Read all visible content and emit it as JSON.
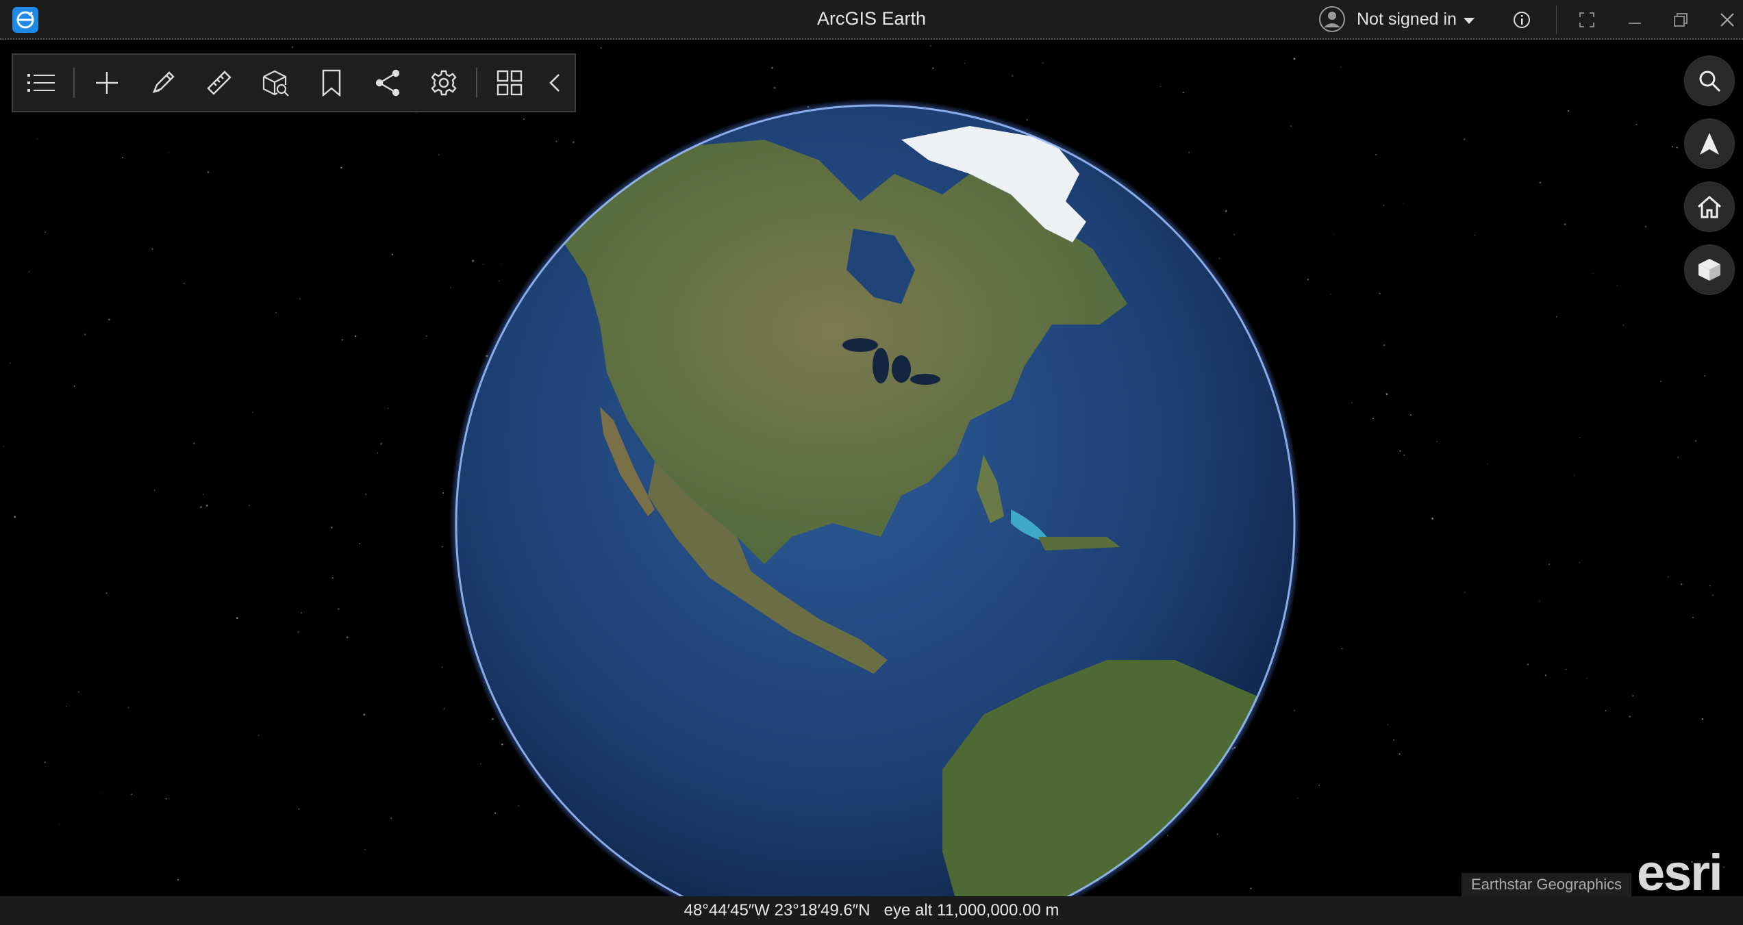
{
  "app": {
    "title": "ArcGIS Earth",
    "logo_icon": "arcgis-earth-logo"
  },
  "account": {
    "label": "Not signed in",
    "icon": "user-avatar-icon"
  },
  "window_controls": [
    "info-icon",
    "fullscreen-icon",
    "minimize-icon",
    "restore-icon",
    "close-icon"
  ],
  "toolbar": {
    "buttons": [
      "menu-list-icon",
      "add-icon",
      "draw-icon",
      "measure-icon",
      "analysis-icon",
      "bookmark-icon",
      "share-icon",
      "settings-icon",
      "apps-grid-icon",
      "collapse-icon"
    ]
  },
  "navigation": [
    "search-icon",
    "compass-icon",
    "home-icon",
    "3d-view-icon"
  ],
  "attribution": "Earthstar Geographics",
  "brand": "esri",
  "status": {
    "coordinates": "48°44′45″W 23°18′49.6″N",
    "eye_altitude": "eye alt 11,000,000.00 m"
  },
  "colors": {
    "titlebar": "#1c1c1c",
    "ocean": "#1d3f73",
    "land": "#6f7a4d",
    "ice": "#f1f3f4",
    "atmosphere": "#5a8cff"
  }
}
